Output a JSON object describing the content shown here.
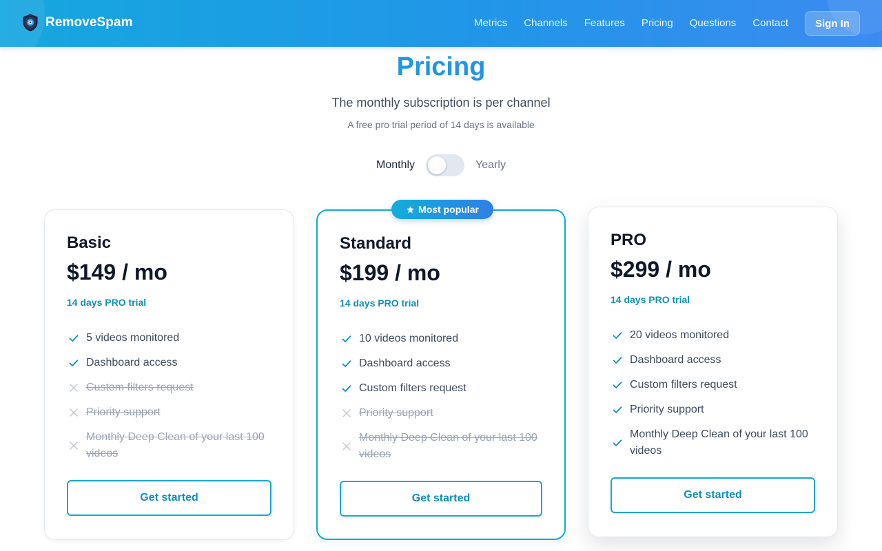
{
  "brand": {
    "name": "RemoveSpam"
  },
  "nav": {
    "items": [
      {
        "label": "Metrics"
      },
      {
        "label": "Channels"
      },
      {
        "label": "Features"
      },
      {
        "label": "Pricing"
      },
      {
        "label": "Questions"
      },
      {
        "label": "Contact"
      }
    ],
    "signin_label": "Sign In"
  },
  "hero": {
    "title": "Pricing",
    "subtitle": "The monthly subscription is per channel",
    "note": "A free pro trial period of 14 days is available"
  },
  "billing_toggle": {
    "left_label": "Monthly",
    "right_label": "Yearly",
    "selected": "Monthly"
  },
  "colors": {
    "accent": "#12a9d1",
    "brand_gradient_start": "#16a7df",
    "brand_gradient_end": "#3b8bf0"
  },
  "plans": [
    {
      "name": "Basic",
      "price": "$149 / mo",
      "trial": "14 days PRO trial",
      "features": [
        {
          "text": "5 videos monitored",
          "included": true
        },
        {
          "text": "Dashboard access",
          "included": true
        },
        {
          "text": "Custom filters request",
          "included": false
        },
        {
          "text": "Priority support",
          "included": false
        },
        {
          "text": "Monthly Deep Clean of your last 100 videos",
          "included": false
        }
      ],
      "cta": "Get started"
    },
    {
      "name": "Standard",
      "badge": "Most popular",
      "price": "$199 / mo",
      "trial": "14 days PRO trial",
      "features": [
        {
          "text": "10 videos monitored",
          "included": true
        },
        {
          "text": "Dashboard access",
          "included": true
        },
        {
          "text": "Custom filters request",
          "included": true
        },
        {
          "text": "Priority support",
          "included": false
        },
        {
          "text": "Monthly Deep Clean of your last 100 videos",
          "included": false
        }
      ],
      "cta": "Get started"
    },
    {
      "name": "PRO",
      "price": "$299 / mo",
      "trial": "14 days PRO trial",
      "features": [
        {
          "text": "20 videos monitored",
          "included": true
        },
        {
          "text": "Dashboard access",
          "included": true
        },
        {
          "text": "Custom filters request",
          "included": true
        },
        {
          "text": "Priority support",
          "included": true
        },
        {
          "text": "Monthly Deep Clean of your last 100 videos",
          "included": true
        }
      ],
      "cta": "Get started"
    }
  ]
}
